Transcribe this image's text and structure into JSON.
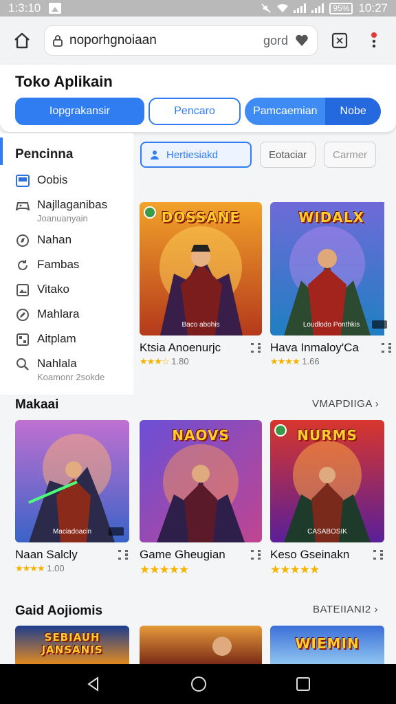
{
  "status_bar": {
    "time_left": "1:3:10",
    "battery": "95%",
    "time_right": "10:27"
  },
  "browser": {
    "url": "noporhgnoiaan",
    "url_suffix": "gord"
  },
  "header": {
    "title": "Toko Aplikain",
    "tabs": [
      {
        "label": "Iopgrakansir"
      },
      {
        "label": "Pencaro"
      },
      {
        "label": "Pamcaemian"
      },
      {
        "label": "Nobe"
      }
    ]
  },
  "sidebar": {
    "title": "Pencinna",
    "items": [
      {
        "label": "Oobis",
        "icon": "square-icon"
      },
      {
        "label": "Najllaganibas",
        "sub": "Joanuanyain",
        "icon": "gamepad-icon"
      },
      {
        "label": "Nahan",
        "icon": "compass-icon"
      },
      {
        "label": "Fambas",
        "icon": "refresh-icon"
      },
      {
        "label": "Vitako",
        "icon": "image-icon"
      },
      {
        "label": "Mahlara",
        "icon": "edit-icon"
      },
      {
        "label": "Aitplam",
        "icon": "grid-icon"
      },
      {
        "label": "Nahlala",
        "sub": "Koamonr 2sokde",
        "icon": "search-icon"
      }
    ]
  },
  "filters": [
    {
      "label": "Hertiesiakd",
      "active": true
    },
    {
      "label": "Eotaciar",
      "active": false
    },
    {
      "label": "Carmer",
      "active": false
    }
  ],
  "top_games": [
    {
      "name": "Ktsia Anoenurjc",
      "rating": "1.80",
      "art_title": "DOSSANE",
      "caption": "Baco abohis",
      "palette": [
        "#f2a22a",
        "#b4391b"
      ]
    },
    {
      "name": "Hava Inmaloy'Ca",
      "rating": "1.66",
      "art_title": "WIDALX",
      "caption": "Loudlodo Ponthkis",
      "palette": [
        "#6f6ad8",
        "#1f7fc2"
      ]
    }
  ],
  "section1": {
    "title": "Makaai",
    "link": "VMAPDIIGA"
  },
  "row_games": [
    {
      "name": "Naan Salcly",
      "rating": "1.00",
      "caption": "Maciadoacin",
      "palette": [
        "#c070d0",
        "#3a63c7"
      ]
    },
    {
      "name": "Game Gheugian",
      "rating": "",
      "art_title": "NAOVS",
      "caption": "",
      "palette": [
        "#6b4fd6",
        "#c04590"
      ]
    },
    {
      "name": "Keso Gseinakn",
      "rating": "",
      "art_title": "NURMS",
      "caption": "CASABOSIK",
      "palette": [
        "#d8362b",
        "#5a1f99"
      ]
    }
  ],
  "section2": {
    "title": "Gaid Aojiomis",
    "link": "BATEIIANI2"
  },
  "bottom_games": [
    {
      "art_title": "SEBIAUH JANSANIS",
      "palette": [
        "#1e3c8f",
        "#e08a21"
      ]
    },
    {
      "art_title": "",
      "palette": [
        "#e69a3a",
        "#7a2b16"
      ]
    },
    {
      "art_title": "WIEMIN",
      "palette": [
        "#3b6fd8",
        "#8fc4f0"
      ]
    }
  ]
}
